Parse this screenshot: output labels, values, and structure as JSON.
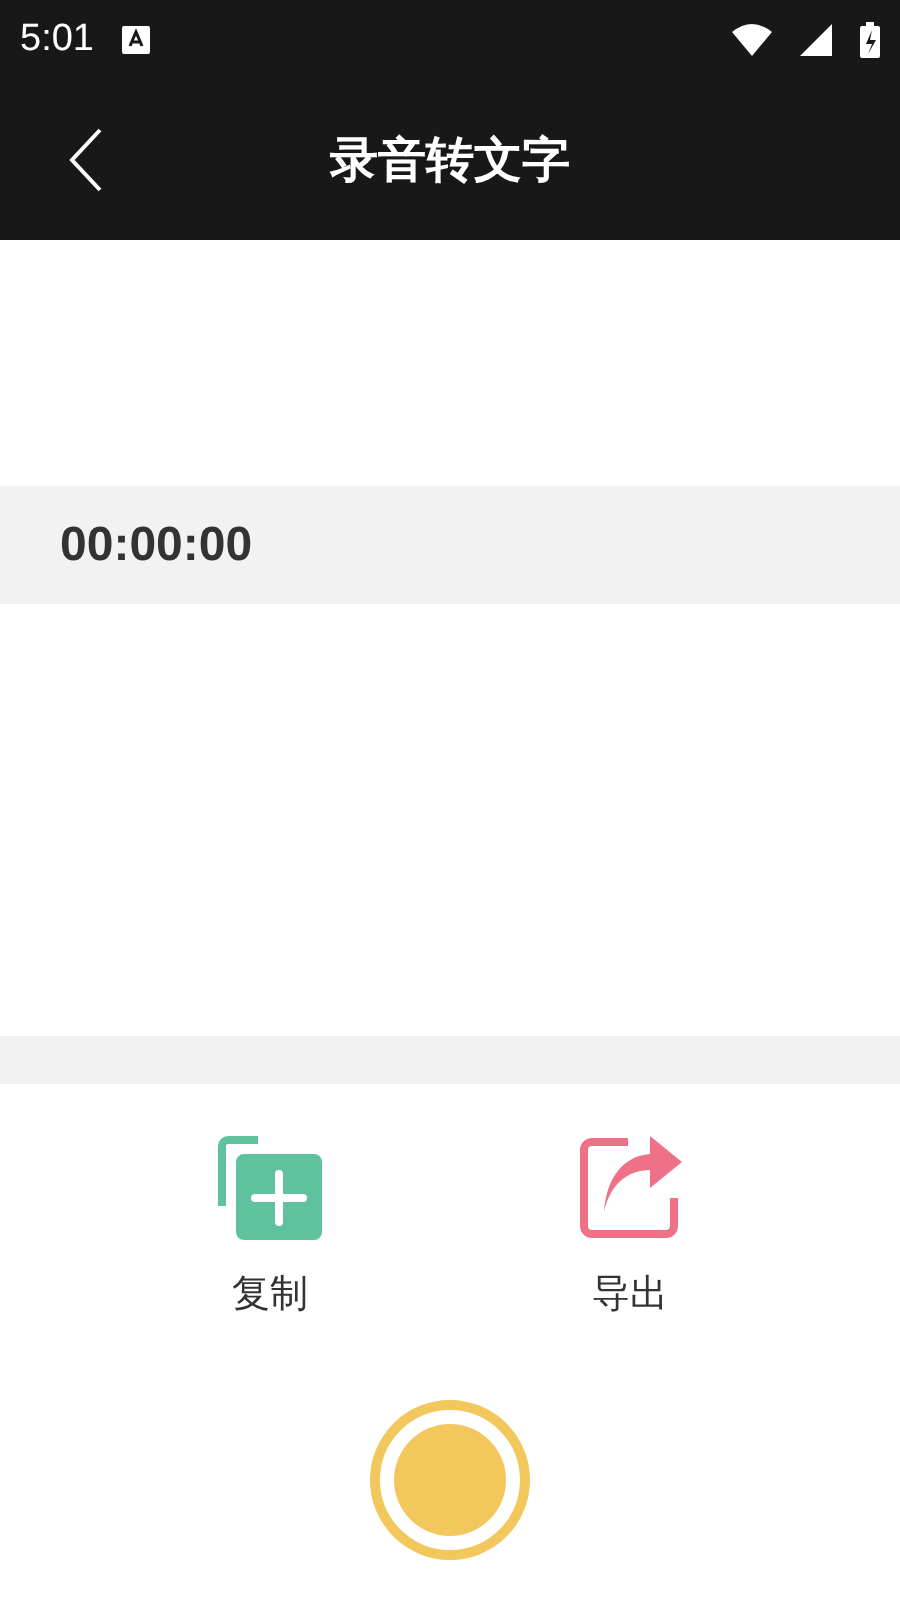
{
  "status_bar": {
    "time": "5:01"
  },
  "header": {
    "title": "录音转文字"
  },
  "timer": "00:00:00",
  "actions": [
    {
      "kind": "copy",
      "label": "复制"
    },
    {
      "kind": "export",
      "label": "导出"
    }
  ],
  "record_button": {
    "recording": false
  }
}
